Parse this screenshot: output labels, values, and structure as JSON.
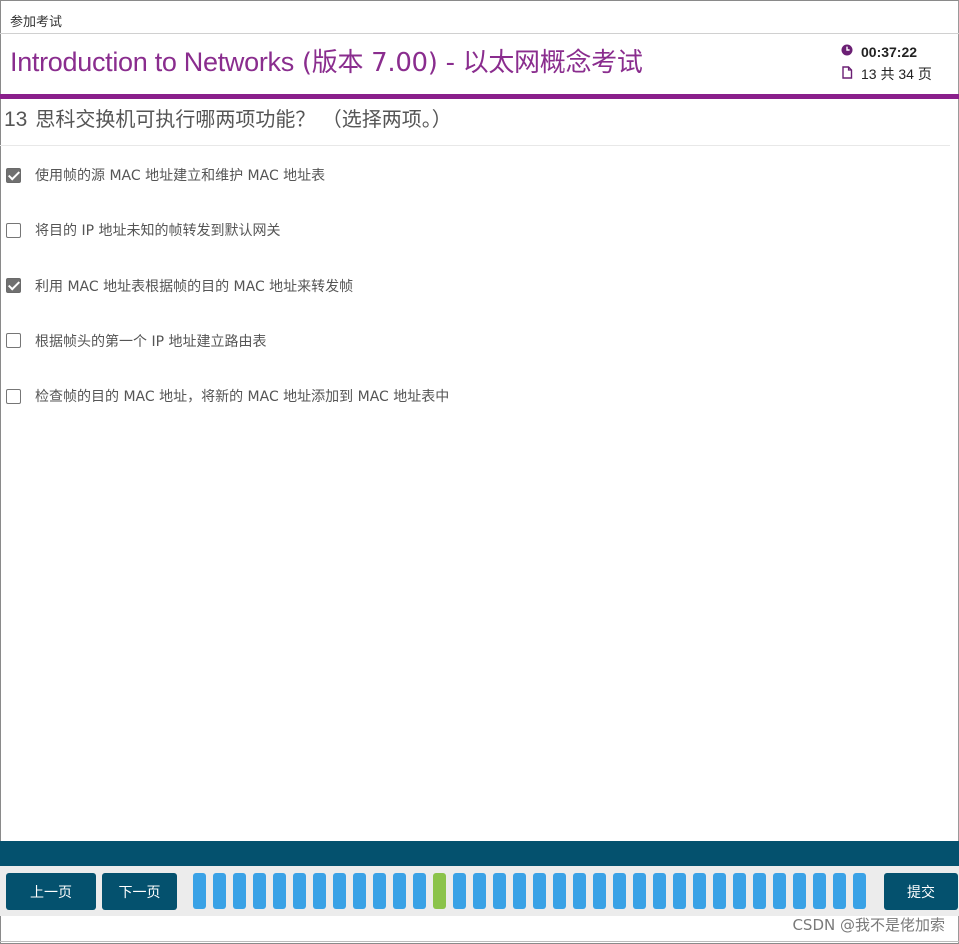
{
  "window": {
    "title": "参加考试"
  },
  "exam": {
    "title_en": "Introduction to Networks",
    "title_rest": " (版本 7.00) - 以太网概念考试",
    "timer": "00:37:22",
    "page_indicator": "13 共 34 页"
  },
  "question": {
    "number": "13",
    "text": "思科交换机可执行哪两项功能？ （选择两项。）"
  },
  "options": [
    {
      "label": "使用帧的源 MAC 地址建立和维护 MAC 地址表",
      "checked": true
    },
    {
      "label": "将目的 IP 地址未知的帧转发到默认网关",
      "checked": false
    },
    {
      "label": "利用 MAC 地址表根据帧的目的 MAC 地址来转发帧",
      "checked": true
    },
    {
      "label": "根据帧头的第一个 IP 地址建立路由表",
      "checked": false
    },
    {
      "label": "检查帧的目的 MAC 地址，将新的 MAC 地址添加到 MAC 地址表中",
      "checked": false
    }
  ],
  "nav": {
    "prev_label": "上一页",
    "next_label": "下一页",
    "submit_label": "提交",
    "total_pages": 34,
    "current_page": 13,
    "tick_color": "#3aa2e6",
    "current_tick_color": "#8bc34a"
  },
  "icons": {
    "timer": "clock-icon",
    "pages": "document-icon"
  },
  "colors": {
    "title": "#8a2d8e",
    "accent_bar": "#8a1f8b",
    "nav": "#04516e"
  },
  "watermark": "CSDN @我不是佬加索"
}
